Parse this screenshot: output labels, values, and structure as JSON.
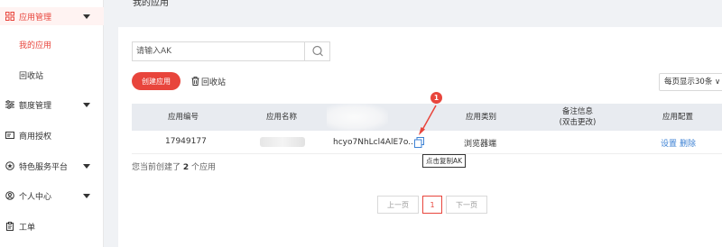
{
  "sidebar": {
    "groups": [
      {
        "icon": "grid-apps-icon",
        "label": "应用管理",
        "expanded": true
      },
      {
        "icon": "sliders-icon",
        "label": "额度管理",
        "expanded": false
      },
      {
        "icon": "card-icon",
        "label": "商用授权"
      },
      {
        "icon": "star-badge-icon",
        "label": "特色服务平台",
        "expanded": false
      },
      {
        "icon": "user-icon",
        "label": "个人中心",
        "expanded": false
      },
      {
        "icon": "clipboard-icon",
        "label": "工单"
      }
    ],
    "sub_items": [
      {
        "label": "我的应用",
        "active": true
      },
      {
        "label": "回收站",
        "active": false
      }
    ]
  },
  "page": {
    "title": "我的应用"
  },
  "search": {
    "placeholder": "请输入AK",
    "value": ""
  },
  "toolbar": {
    "create_label": "创建应用",
    "recycle_label": "回收站",
    "page_size_label": "每页显示30条"
  },
  "table": {
    "headers": [
      "应用编号",
      "应用名称",
      "AK",
      "应用类别",
      "备注信息",
      "(双击更改)",
      "应用配置"
    ],
    "rows": [
      {
        "id": "17949177",
        "name": "",
        "ak": "hcyo7NhLcl4AlE7o...",
        "category": "浏览器端",
        "remark": "",
        "ops": [
          "设置",
          "删除"
        ]
      }
    ]
  },
  "tooltip": {
    "text": "点击复制AK"
  },
  "annotation": {
    "badge": "1",
    "color": "#e8453c"
  },
  "summary": {
    "prefix": "您当前创建了",
    "count": "2",
    "suffix": "个应用"
  },
  "pagination": {
    "prev": "上一页",
    "current": "1",
    "next": "下一页"
  },
  "colors": {
    "accent": "#e8453c",
    "link": "#3d82d4",
    "header_bg": "#e8ebf0"
  }
}
